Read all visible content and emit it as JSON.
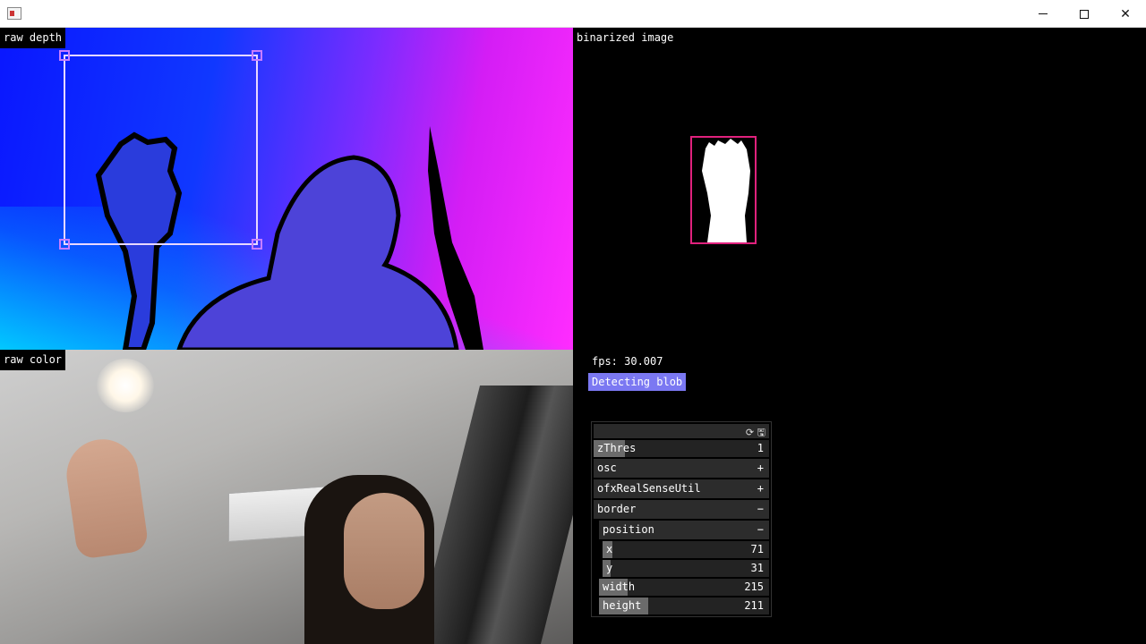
{
  "window": {
    "minimize_icon": "minimize-icon",
    "maximize_icon": "maximize-icon",
    "close_glyph": "✕"
  },
  "panels": {
    "depth_label": "raw depth",
    "binary_label": "binarized image",
    "color_label": "raw color"
  },
  "stats": {
    "fps": "fps: 30.007",
    "status": "Detecting blob"
  },
  "gui": {
    "header_icons": "⟳ 🖫",
    "zthres": {
      "name": "zThres",
      "value": "1",
      "fill_fraction": 0.18
    },
    "groups": {
      "osc": {
        "name": "osc",
        "sign": "+"
      },
      "realsense": {
        "name": "ofxRealSenseUtil",
        "sign": "+"
      },
      "border": {
        "name": "border",
        "sign": "−"
      },
      "position": {
        "name": "position",
        "sign": "−"
      }
    },
    "x": {
      "name": "x",
      "value": "71",
      "fill_fraction": 0.06
    },
    "y": {
      "name": "y",
      "value": "31",
      "fill_fraction": 0.05
    },
    "width": {
      "name": "width",
      "value": "215",
      "fill_fraction": 0.17
    },
    "height": {
      "name": "height",
      "value": "211",
      "fill_fraction": 0.29
    }
  },
  "colors": {
    "status_badge": "#7b78f2",
    "selection_rect": "#e8d8ff",
    "blob_box": "#e0217d"
  }
}
